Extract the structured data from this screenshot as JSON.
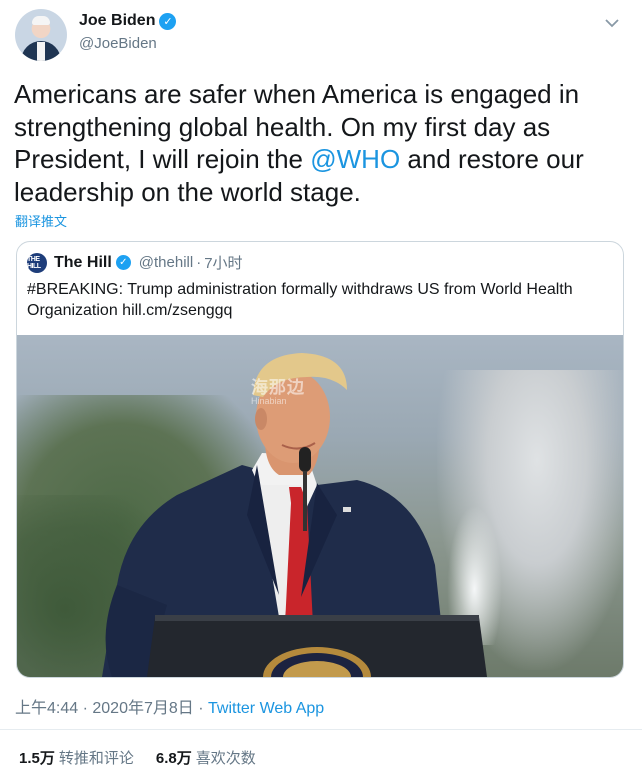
{
  "author": {
    "display_name": "Joe Biden",
    "handle": "@JoeBiden",
    "verified": true
  },
  "tweet": {
    "text_before": "Americans are safer when America is engaged in strengthening global health. On my first day as President, I will rejoin the ",
    "mention": "@WHO",
    "text_after": " and restore our leadership on the world stage.",
    "translate_label": "翻译推文"
  },
  "quoted": {
    "logo_text": "THE HILL",
    "display_name": "The Hill",
    "handle": "@thehill",
    "separator": "·",
    "time": "7小时",
    "verified": true,
    "text": "#BREAKING: Trump administration formally withdraws US from World Health Organization hill.cm/zsenggq",
    "watermark": "海那边",
    "watermark_sub": "Hinabian"
  },
  "meta": {
    "time": "上午4:44",
    "separator": " · ",
    "date": "2020年7月8日",
    "source": "Twitter Web App"
  },
  "stats": {
    "retweets_count": "1.5万",
    "retweets_label": "转推和评论",
    "likes_count": "6.8万",
    "likes_label": "喜欢次数"
  },
  "icons": {
    "verified": "verified-badge-icon",
    "menu": "chevron-down-icon"
  },
  "colors": {
    "link": "#1b95e0",
    "verified": "#1da1f2",
    "muted": "#657786",
    "border": "#ccd6dd"
  }
}
